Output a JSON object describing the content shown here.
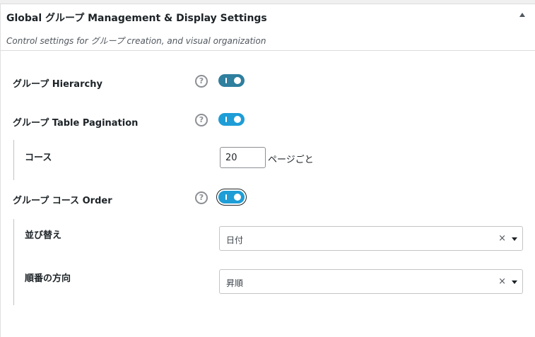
{
  "panel": {
    "title": "Global グループ Management & Display Settings",
    "description": "Control settings for グループ creation, and visual organization",
    "collapse_icon": "triangle-up-icon"
  },
  "settings": {
    "hierarchy": {
      "label": "グループ Hierarchy",
      "help": "?",
      "enabled": true,
      "color": "#2f7f9e"
    },
    "pagination": {
      "label": "グループ Table Pagination",
      "help": "?",
      "enabled": true,
      "color": "#1e9dd6",
      "courses": {
        "label": "コース",
        "value": "20",
        "suffix": "ページごと"
      }
    },
    "course_order": {
      "label": "グループ コース Order",
      "help": "?",
      "enabled": true,
      "color": "#1e9dd6",
      "sort": {
        "label": "並び替え",
        "value": "日付",
        "clear": "×"
      },
      "direction": {
        "label": "順番の方向",
        "value": "昇順",
        "clear": "×"
      }
    }
  }
}
